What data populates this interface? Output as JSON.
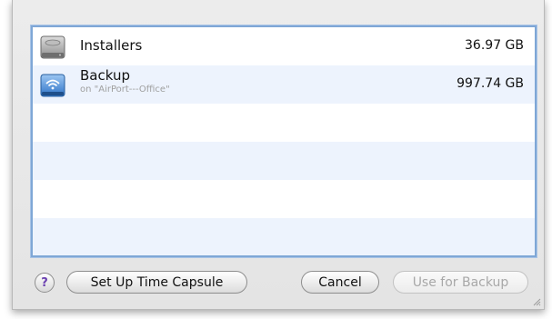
{
  "disks": [
    {
      "name": "Installers",
      "subtitle": "",
      "size": "36.97 GB",
      "icon": "internal-drive-icon"
    },
    {
      "name": "Backup",
      "subtitle": "on \"AirPort---Office\"",
      "size": "997.74 GB",
      "icon": "network-drive-icon"
    }
  ],
  "buttons": {
    "help": "?",
    "setup_time_capsule": "Set Up Time Capsule",
    "cancel": "Cancel",
    "use_for_backup": "Use for Backup"
  },
  "colors": {
    "selection_border": "#7fa7d6",
    "alt_row": "#edf3fd",
    "help_accent": "#6a3fb0"
  }
}
